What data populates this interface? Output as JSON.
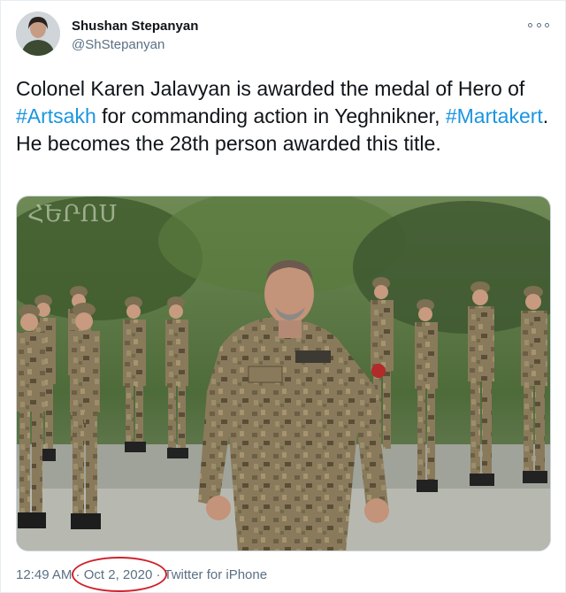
{
  "author": {
    "display_name": "Shushan Stepanyan",
    "handle": "@ShStepanyan",
    "avatar_icon": "user-avatar"
  },
  "tweet": {
    "text_part1": "Colonel Karen Jalavyan is awarded the medal of Hero of ",
    "hashtag1": "#Artsakh",
    "text_part2": " for commanding action in Yeghnikner, ",
    "hashtag2": "#Martakert",
    "text_part3": ". He becomes the 28th person awarded this title."
  },
  "media": {
    "watermark": "ՀԵՐՈՍ",
    "image_icon": "photo-soldiers-lineup"
  },
  "meta": {
    "time": "12:49 AM",
    "sep1": " · ",
    "date": "Oct 2, 2020",
    "sep2": " · ",
    "source": "Twitter for iPhone"
  },
  "colors": {
    "link": "#1b95e0",
    "secondary_text": "#5b7083",
    "highlight_circle": "#d0202a"
  },
  "icons": {
    "more": "more-options-icon"
  }
}
